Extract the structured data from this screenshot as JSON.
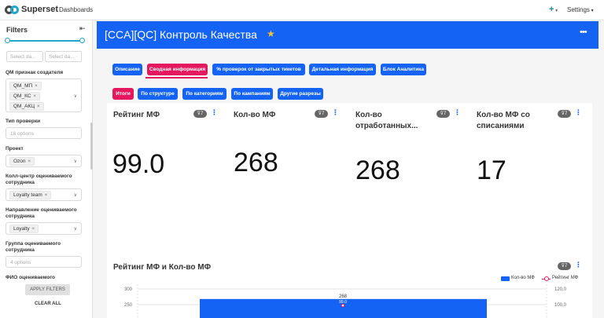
{
  "topbar": {
    "logo": "Superset",
    "nav_dashboards": "Dashboards",
    "plus": "+",
    "settings": "Settings"
  },
  "sidebar": {
    "title": "Filters",
    "date_start_placeholder": "Select da...",
    "date_end_placeholder": "Select da...",
    "filters": [
      {
        "label": "QM признак создателя",
        "tags": [
          "QM_МП",
          "QM_КС",
          "QM_АКЦ"
        ]
      },
      {
        "label": "Тип проверки",
        "placeholder": "18 options"
      },
      {
        "label": "Проект",
        "tags": [
          "Ozon"
        ]
      },
      {
        "label": "Колл-центр оцениваемого сотрудника",
        "tags": [
          "Loyalty team"
        ]
      },
      {
        "label": "Направление оцениваемого сотрудника",
        "tags": [
          "Loyalty"
        ]
      },
      {
        "label": "Группа оцениваемого сотрудника",
        "placeholder": "4 options"
      },
      {
        "label": "ФИО оцениваемого"
      }
    ],
    "apply": "APPLY FILTERS",
    "clear": "CLEAR ALL"
  },
  "header": {
    "title": "[CCA][QC] Контроль Качества"
  },
  "tabs": [
    {
      "label": "Описание"
    },
    {
      "label": "Сводная информация"
    },
    {
      "label": "% проверок от закрытых тикетов"
    },
    {
      "label": "Детальная информация"
    },
    {
      "label": "Блок Аналитика"
    }
  ],
  "subtabs": [
    {
      "label": "Итоги"
    },
    {
      "label": "По структуре"
    },
    {
      "label": "По категориям"
    },
    {
      "label": "По кампаниям"
    },
    {
      "label": "Другие разрезы"
    }
  ],
  "metrics": [
    {
      "title": "Рейтинг МФ",
      "value": "99.0",
      "badge": "7"
    },
    {
      "title": "Кол-во МФ",
      "value": "268",
      "badge": "7"
    },
    {
      "title": "Кол-во отработанных...",
      "value": "268",
      "badge": "7"
    },
    {
      "title": "Кол-во МФ со списаниями",
      "value": "17",
      "badge": "7"
    }
  ],
  "chart_badge": "7",
  "filter_icon": "⊽",
  "colors": {
    "primary": "#1463f4",
    "accent": "#e5175e",
    "brand": "#20a7c9"
  },
  "chart_data": {
    "type": "bar",
    "title": "Рейтинг МФ и Кол-во МФ",
    "series": [
      {
        "name": "Кол-во МФ",
        "type": "bar",
        "axis": "left",
        "values": [
          268
        ]
      },
      {
        "name": "Рейтинг МФ",
        "type": "line",
        "axis": "right",
        "values": [
          99.0
        ]
      }
    ],
    "data_labels": [
      "268",
      "99.0"
    ],
    "y_ticks_left": [
      "300",
      "250"
    ],
    "y_ticks_right": [
      "120,0",
      "100,0"
    ],
    "ylim_left": [
      0,
      300
    ],
    "ylim_right": [
      0,
      120
    ],
    "legend_position": "top-right",
    "grid": true
  }
}
